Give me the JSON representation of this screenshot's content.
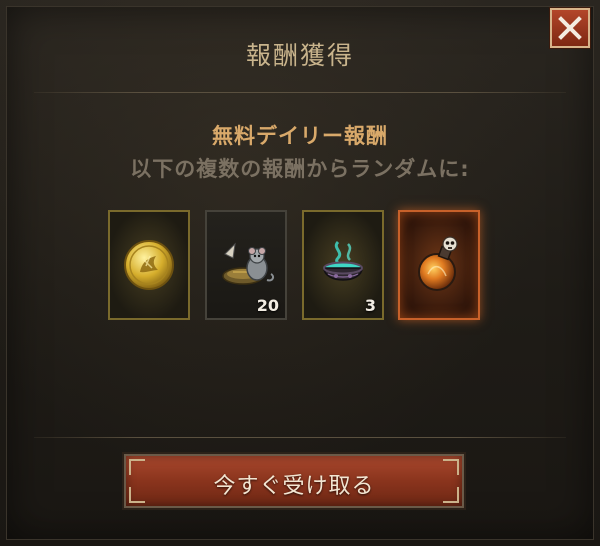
{
  "dialog": {
    "title": "報酬獲得",
    "close_icon": "close-icon"
  },
  "reward": {
    "heading": "無料デイリー報酬",
    "description": "以下の複数の報酬からランダムに:",
    "items": [
      {
        "icon": "gold-coin-icon",
        "count": "",
        "frame": "gold"
      },
      {
        "icon": "rats-with-shield-icon",
        "count": "20",
        "frame": "dark"
      },
      {
        "icon": "cauldron-icon",
        "count": "3",
        "frame": "gold"
      },
      {
        "icon": "skull-potion-icon",
        "count": "",
        "frame": "orange"
      }
    ]
  },
  "actions": {
    "claim_label": "今すぐ受け取る"
  },
  "colors": {
    "title": "#c9b48c",
    "heading": "#d9a96a",
    "description": "#7b7162",
    "claim_button": "#8a341d",
    "close_button": "#a83d22",
    "legendary_frame": "#c8612a"
  }
}
